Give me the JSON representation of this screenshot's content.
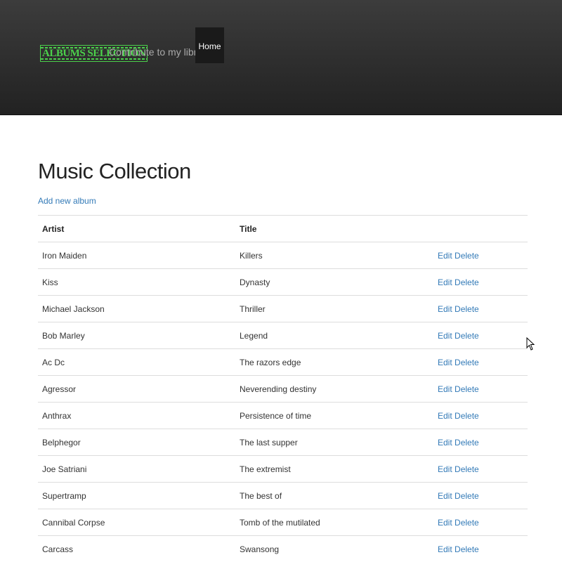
{
  "header": {
    "logo_text": "Albums Selection",
    "tagline": "Contribute to my library",
    "nav": [
      {
        "label": "Home",
        "active": true
      }
    ]
  },
  "main": {
    "title": "Music Collection",
    "add_link": "Add new album",
    "columns": [
      "Artist",
      "Title",
      ""
    ],
    "rows": [
      {
        "artist": "Iron Maiden",
        "title": "Killers",
        "edit": "Edit",
        "delete": "Delete"
      },
      {
        "artist": "Kiss",
        "title": "Dynasty",
        "edit": "Edit",
        "delete": "Delete"
      },
      {
        "artist": "Michael Jackson",
        "title": "Thriller",
        "edit": "Edit",
        "delete": "Delete"
      },
      {
        "artist": "Bob Marley",
        "title": "Legend",
        "edit": "Edit",
        "delete": "Delete"
      },
      {
        "artist": "Ac Dc",
        "title": "The razors edge",
        "edit": "Edit",
        "delete": "Delete"
      },
      {
        "artist": "Agressor",
        "title": "Neverending destiny",
        "edit": "Edit",
        "delete": "Delete"
      },
      {
        "artist": "Anthrax",
        "title": "Persistence of time",
        "edit": "Edit",
        "delete": "Delete"
      },
      {
        "artist": "Belphegor",
        "title": "The last supper",
        "edit": "Edit",
        "delete": "Delete"
      },
      {
        "artist": "Joe Satriani",
        "title": "The extremist",
        "edit": "Edit",
        "delete": "Delete"
      },
      {
        "artist": "Supertramp",
        "title": "The best of",
        "edit": "Edit",
        "delete": "Delete"
      },
      {
        "artist": "Cannibal Corpse",
        "title": "Tomb of the mutilated",
        "edit": "Edit",
        "delete": "Delete"
      },
      {
        "artist": "Carcass",
        "title": "Swansong",
        "edit": "Edit",
        "delete": "Delete"
      }
    ]
  },
  "colors": {
    "navbar_top": "#3c3c3c",
    "navbar_bottom": "#222222",
    "logo_green": "#4bd14b",
    "link": "#337ab7",
    "row_border": "#dddddd"
  }
}
